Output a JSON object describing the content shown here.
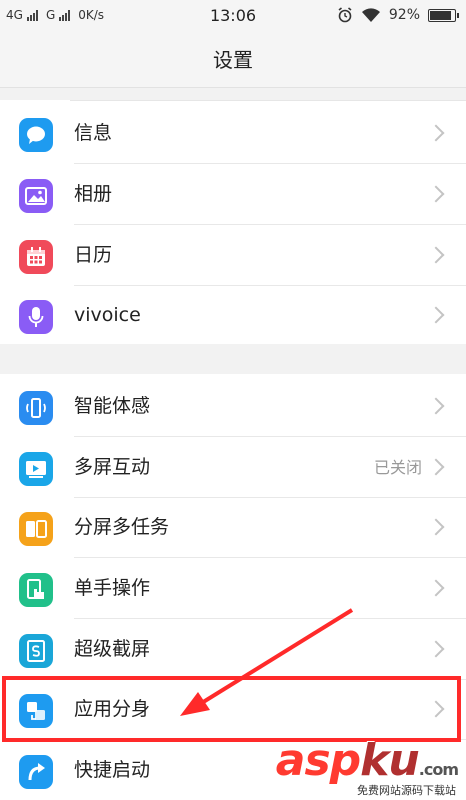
{
  "status_bar": {
    "sim1": "4G",
    "sim2": "G",
    "speed": "0K/s",
    "time": "13:06",
    "battery": "92%",
    "battery_level": 0.92
  },
  "header": {
    "title": "设置"
  },
  "groups": [
    {
      "items": [
        {
          "label": "信息",
          "icon": "message-icon",
          "color": "#1e9bf0"
        },
        {
          "label": "相册",
          "icon": "gallery-icon",
          "color": "#8a5cf5"
        },
        {
          "label": "日历",
          "icon": "calendar-icon",
          "color": "#f04a5a"
        },
        {
          "label": "vivoice",
          "icon": "microphone-icon",
          "color": "#8a5cf5"
        }
      ]
    },
    {
      "items": [
        {
          "label": "智能体感",
          "icon": "phone-motion-icon",
          "color": "#2a8cf0"
        },
        {
          "label": "多屏互动",
          "icon": "multi-screen-icon",
          "color": "#1aa6e8",
          "status": "已关闭"
        },
        {
          "label": "分屏多任务",
          "icon": "split-screen-icon",
          "color": "#f5a21a"
        },
        {
          "label": "单手操作",
          "icon": "one-hand-icon",
          "color": "#21c08a"
        },
        {
          "label": "超级截屏",
          "icon": "screenshot-icon",
          "color": "#1aa6d8"
        },
        {
          "label": "应用分身",
          "icon": "app-clone-icon",
          "color": "#1e9bf0"
        },
        {
          "label": "快捷启动",
          "icon": "quick-launch-icon",
          "color": "#1e9bf0"
        }
      ]
    }
  ],
  "watermark": {
    "main": "asp",
    "accent": "ku",
    "suffix": ".com",
    "sub": "免费网站源码下载站"
  }
}
